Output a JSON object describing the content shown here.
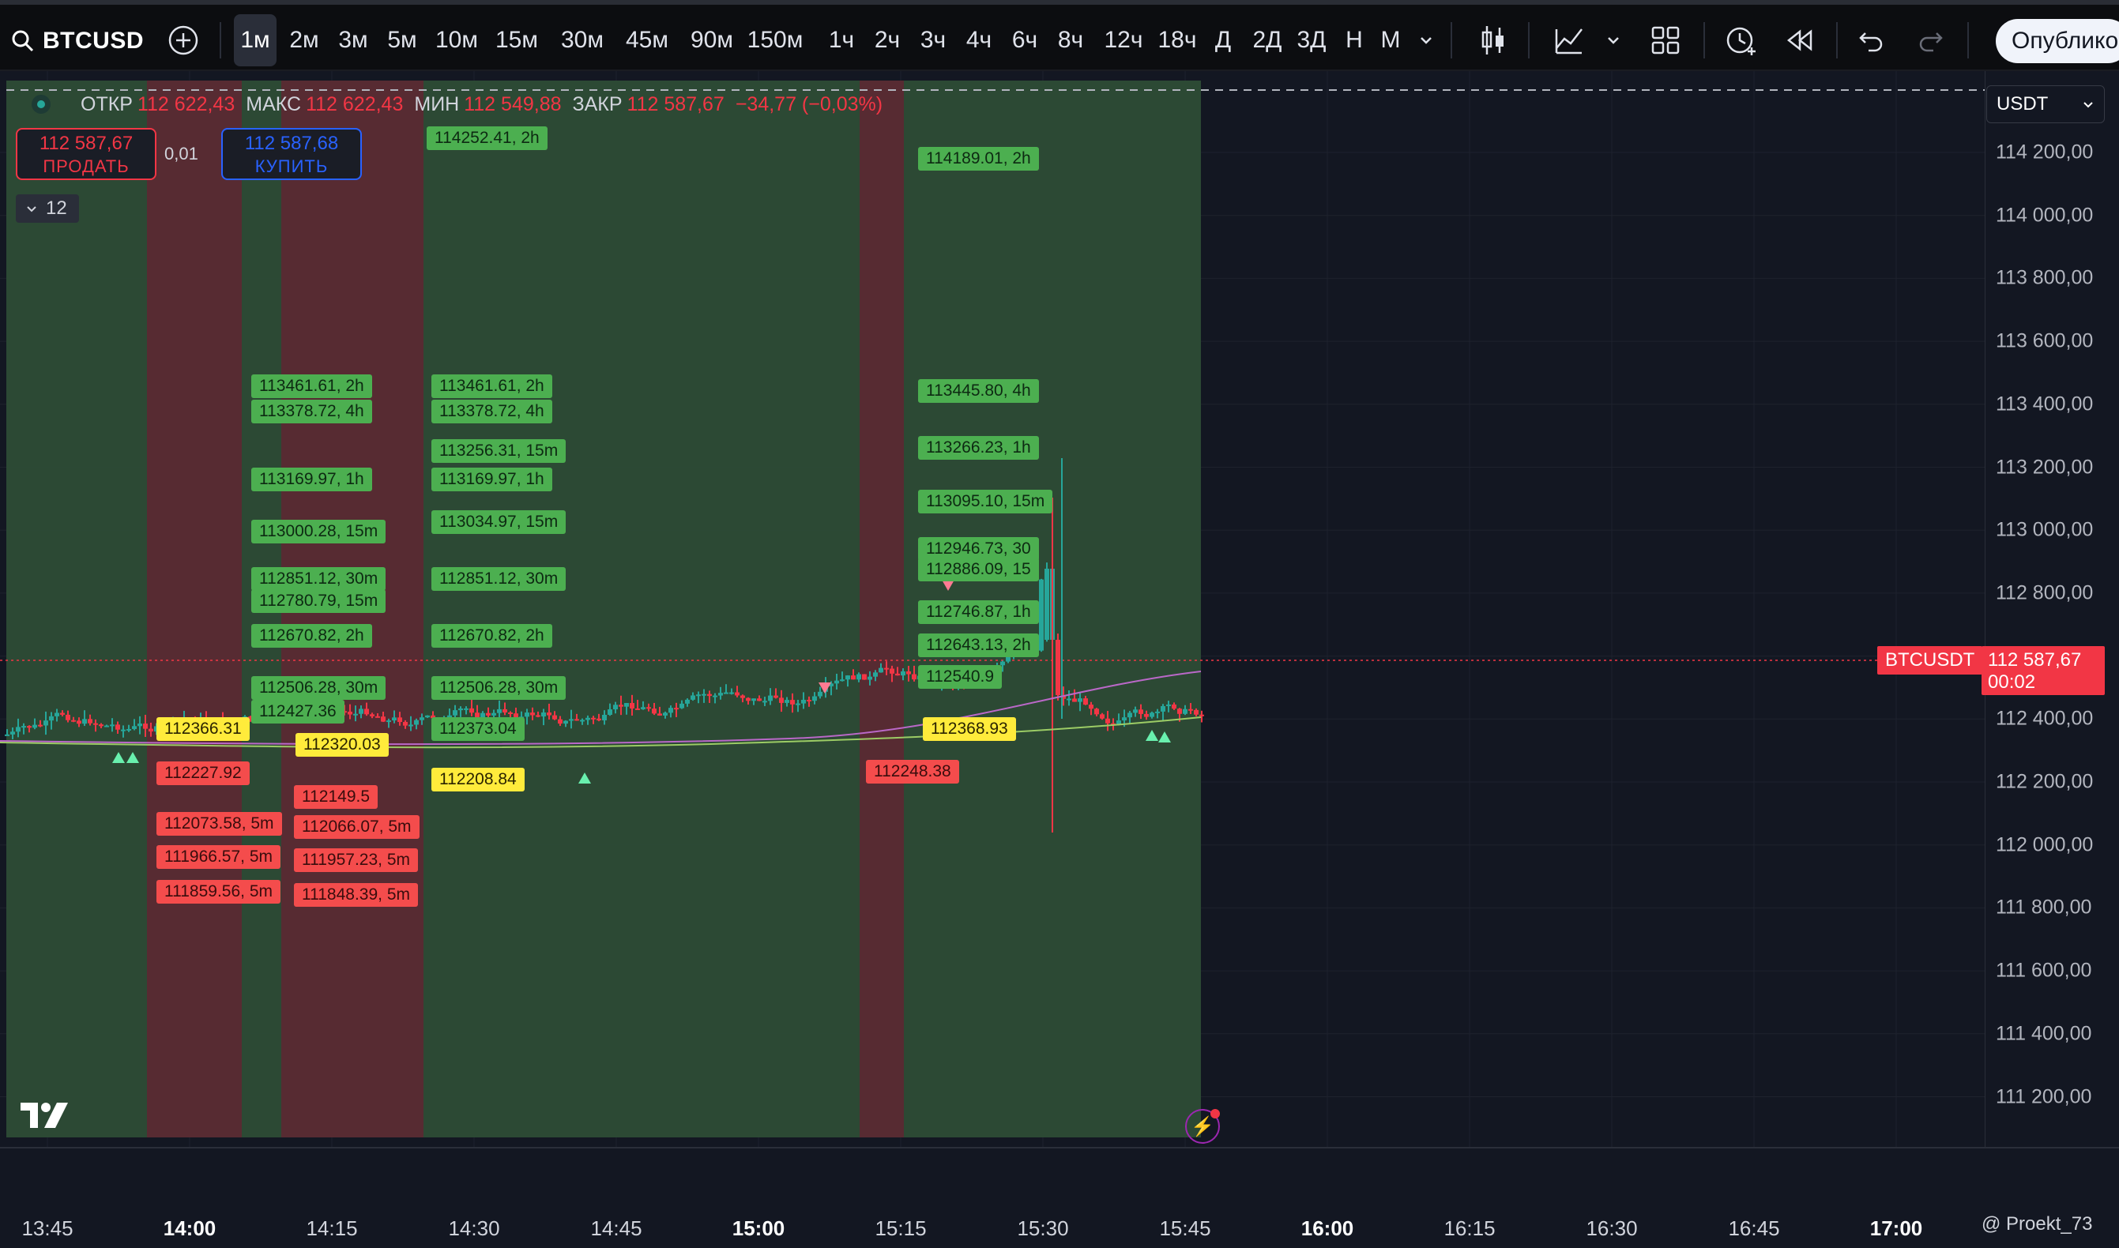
{
  "symbol": "BTCUSD",
  "timeframes": [
    "1м",
    "2м",
    "3м",
    "5м",
    "10м",
    "15м",
    "30м",
    "45м",
    "90м",
    "150м",
    "1ч",
    "2ч",
    "3ч",
    "4ч",
    "6ч",
    "8ч",
    "12ч",
    "18ч",
    "Д",
    "2Д",
    "3Д",
    "Н",
    "М"
  ],
  "active_timeframe": "1м",
  "toolbar": {
    "publish_label": "Опублико"
  },
  "legend": {
    "open_key": "ОТКР",
    "open_val": "112 622,43",
    "high_key": "МАКС",
    "high_val": "112 622,43",
    "low_key": "МИН",
    "low_val": "112 549,88",
    "close_key": "ЗАКР",
    "close_val": "112 587,67",
    "change": "−34,77 (−0,03%)"
  },
  "trade": {
    "sell_price": "112 587,67",
    "sell_label": "ПРОДАТЬ",
    "spread": "0,01",
    "buy_price": "112 587,68",
    "buy_label": "КУПИТЬ"
  },
  "indicators_count": "12",
  "currency": "USDT",
  "price_axis": [
    "114 200,00",
    "114 000,00",
    "113 800,00",
    "113 600,00",
    "113 400,00",
    "113 200,00",
    "113 000,00",
    "112 800,00",
    "112 600,00",
    "112 400,00",
    "112 200,00",
    "112 000,00",
    "111 800,00",
    "111 600,00",
    "111 400,00",
    "111 200,00"
  ],
  "time_axis": [
    "13:45",
    "14:00",
    "14:15",
    "14:30",
    "14:45",
    "15:00",
    "15:15",
    "15:30",
    "15:45",
    "16:00",
    "16:15",
    "16:30",
    "16:45",
    "17:00"
  ],
  "time_axis_major": [
    "14:00",
    "15:00",
    "16:00",
    "17:00"
  ],
  "last_price": {
    "symbol_tag": "BTCUSDT",
    "price": "112 587,67",
    "countdown": "00:02"
  },
  "levels": [
    {
      "text": "114252.41, 2h",
      "color": "g"
    },
    {
      "text": "114189.01, 2h",
      "color": "g"
    },
    {
      "text": "113461.61, 2h",
      "color": "g"
    },
    {
      "text": "113378.72, 4h",
      "color": "g"
    },
    {
      "text": "113461.61, 2h",
      "color": "g"
    },
    {
      "text": "113378.72, 4h",
      "color": "g"
    },
    {
      "text": "113445.80, 4h",
      "color": "g"
    },
    {
      "text": "113256.31, 15m",
      "color": "g"
    },
    {
      "text": "113266.23, 1h",
      "color": "g"
    },
    {
      "text": "113169.97, 1h",
      "color": "g"
    },
    {
      "text": "113169.97, 1h",
      "color": "g"
    },
    {
      "text": "113095.10, 15m",
      "color": "g"
    },
    {
      "text": "113000.28, 15m",
      "color": "g"
    },
    {
      "text": "113034.97, 15m",
      "color": "g"
    },
    {
      "text": "112946.73, 30",
      "color": "g"
    },
    {
      "text": "112886.09, 15",
      "color": "g"
    },
    {
      "text": "112851.12, 30m",
      "color": "g"
    },
    {
      "text": "112780.79, 15m",
      "color": "g"
    },
    {
      "text": "112851.12, 30m",
      "color": "g"
    },
    {
      "text": "112746.87, 1h",
      "color": "g"
    },
    {
      "text": "112670.82, 2h",
      "color": "g"
    },
    {
      "text": "112670.82, 2h",
      "color": "g"
    },
    {
      "text": "112643.13, 2h",
      "color": "g"
    },
    {
      "text": "112540.9",
      "color": "g"
    },
    {
      "text": "112506.28, 30m",
      "color": "g"
    },
    {
      "text": "112506.28, 30m",
      "color": "g"
    },
    {
      "text": "112427.36",
      "color": "g"
    },
    {
      "text": "112373.04",
      "color": "g"
    },
    {
      "text": "112366.31",
      "color": "y"
    },
    {
      "text": "112320.03",
      "color": "y"
    },
    {
      "text": "112368.93",
      "color": "y"
    },
    {
      "text": "112208.84",
      "color": "y"
    },
    {
      "text": "112227.92",
      "color": "r"
    },
    {
      "text": "112149.5",
      "color": "r"
    },
    {
      "text": "112248.38",
      "color": "r"
    },
    {
      "text": "112073.58, 5m",
      "color": "r"
    },
    {
      "text": "112066.07, 5m",
      "color": "r"
    },
    {
      "text": "111966.57, 5m",
      "color": "r"
    },
    {
      "text": "111957.23, 5m",
      "color": "r"
    },
    {
      "text": "111859.56, 5m",
      "color": "r"
    },
    {
      "text": "111848.39, 5m",
      "color": "r"
    }
  ],
  "footer": {
    "user": "@ Proekt_73"
  },
  "colors": {
    "up": "#26a69a",
    "down": "#f23645",
    "green_zone": "#2d4c36",
    "red_zone": "#5a2a33",
    "bg": "#131722"
  },
  "icons": [
    "search-icon",
    "add-symbol-icon",
    "candles-icon",
    "indicators-icon",
    "layout-icon",
    "alert-icon",
    "replay-icon",
    "undo-icon",
    "redo-icon"
  ]
}
